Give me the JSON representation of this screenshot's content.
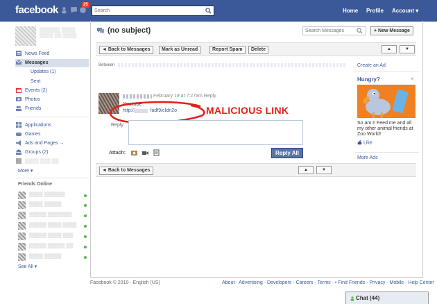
{
  "topbar": {
    "logo": "facebook",
    "notification_count": "25",
    "search_placeholder": "Search",
    "nav": {
      "home": "Home",
      "profile": "Profile",
      "account": "Account ▾"
    }
  },
  "left": {
    "nav": [
      {
        "label": "News Feed",
        "icon": "news-feed-icon"
      },
      {
        "label": "Messages",
        "icon": "messages-icon",
        "selected": true
      },
      {
        "label": "Events (2)",
        "icon": "events-icon"
      },
      {
        "label": "Photos",
        "icon": "photos-icon"
      },
      {
        "label": "Friends",
        "icon": "friends-icon"
      }
    ],
    "sub": {
      "updates": "Updates (1)",
      "sent": "Sent"
    },
    "apps": [
      {
        "label": "Applications",
        "icon": "applications-icon"
      },
      {
        "label": "Games",
        "icon": "games-icon"
      },
      {
        "label": "Ads and Pages →",
        "icon": "ads-icon"
      },
      {
        "label": "Groups (2)",
        "icon": "groups-icon"
      }
    ],
    "more": "More ▾",
    "friends_online_title": "Friends Online",
    "see_all": "See All ▾"
  },
  "main": {
    "title": "(no subject)",
    "search_placeholder": "Search Messages",
    "new_message": "+ New Message",
    "toolbar": {
      "back": "◄ Back to Messages",
      "mark_unread": "Mark as Unread",
      "report_spam": "Report Spam",
      "delete": "Delete",
      "up": "▲",
      "down": "▼"
    },
    "between_label": "Between",
    "message": {
      "date": "February 19 at 7:27am Reply",
      "line1": "You tube",
      "line2_prefix": "http://",
      "line2_suffix": "fadf9/cIdn2o"
    },
    "annotation": "MALICIOUS LINK",
    "reply_label": "Reply:",
    "attach_label": "Attach:",
    "reply_all": "Reply All"
  },
  "ad": {
    "create_ad": "Create an Ad",
    "title": "Hungry?",
    "close": "×",
    "text": "So am I! Feed me and all my other animal friends at Zoo World!",
    "like": "Like",
    "more_ads": "More Ads"
  },
  "footer": {
    "copyright": "Facebook © 2010 · English (US)",
    "links": "About · Advertising · Developers · Careers · Terms · • Find Friends · Privacy · Mobile · Help Center"
  },
  "chat": {
    "label": "Chat (44)"
  }
}
